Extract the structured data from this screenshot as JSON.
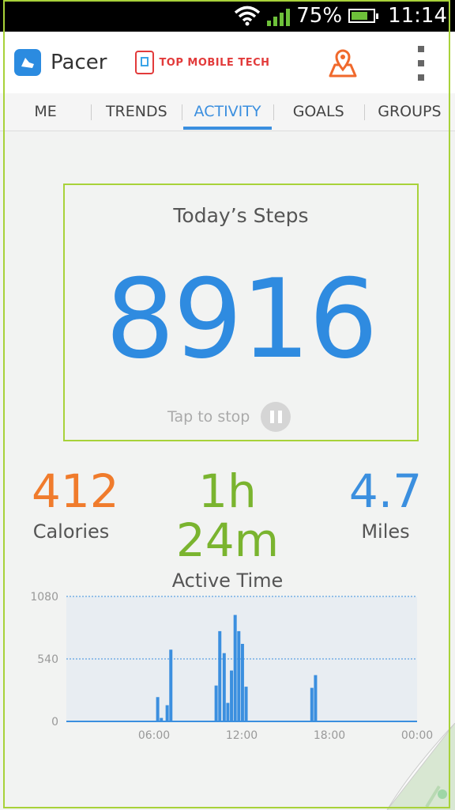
{
  "status_bar": {
    "battery": "75%",
    "time": "11:14"
  },
  "app": {
    "title": "Pacer",
    "brand_watermark": "TOP MOBILE TECH"
  },
  "tabs": [
    {
      "label": "ME",
      "active": false
    },
    {
      "label": "TRENDS",
      "active": false
    },
    {
      "label": "ACTIVITY",
      "active": true
    },
    {
      "label": "GOALS",
      "active": false
    },
    {
      "label": "GROUPS",
      "active": false
    }
  ],
  "steps": {
    "title": "Today’s Steps",
    "value": "8916",
    "tap_to_stop": "Tap to stop"
  },
  "stats": {
    "calories": {
      "value": "412",
      "label": "Calories"
    },
    "active_time": {
      "value": "1h 24m",
      "label": "Active Time"
    },
    "miles": {
      "value": "4.7",
      "label": "Miles"
    }
  },
  "colors": {
    "accent": "#3b8fdf",
    "calories": "#f07b2c",
    "active_time": "#7ab42f",
    "frame": "#a8d23a"
  },
  "icons": [
    "wifi-icon",
    "signal-icon",
    "battery-icon",
    "pacer-logo-icon",
    "map-pin-icon",
    "more-vert-icon",
    "pause-icon"
  ],
  "chart_data": {
    "type": "bar",
    "x_unit": "hour of day",
    "xlim": [
      0,
      24
    ],
    "ylim": [
      0,
      1080
    ],
    "yticks": [
      "0",
      "540",
      "1080"
    ],
    "xticks": [
      "06:00",
      "12:00",
      "18:00",
      "00:00"
    ],
    "xtick_positions": [
      6,
      12,
      18,
      24
    ],
    "grid": "dotted horizontal at 540 and 1080",
    "x": [
      6.25,
      6.5,
      6.9,
      7.15,
      10.25,
      10.5,
      10.8,
      11.05,
      11.3,
      11.55,
      11.8,
      12.05,
      12.3,
      16.8,
      17.05
    ],
    "values": [
      210,
      30,
      140,
      620,
      310,
      780,
      590,
      160,
      440,
      920,
      780,
      670,
      300,
      290,
      400
    ]
  }
}
